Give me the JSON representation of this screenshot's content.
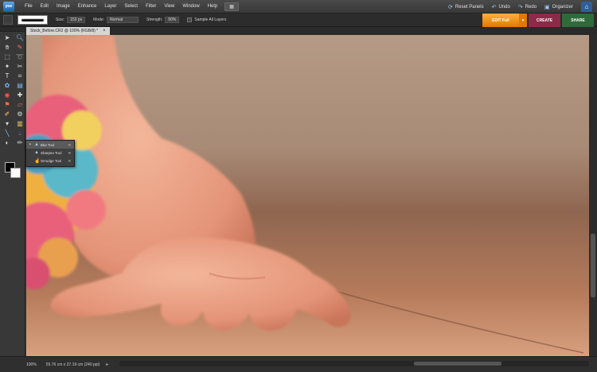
{
  "app": {
    "logo": "pse"
  },
  "menu": [
    "File",
    "Edit",
    "Image",
    "Enhance",
    "Layer",
    "Select",
    "Filter",
    "View",
    "Window",
    "Help"
  ],
  "right_actions": {
    "reset_panels": "Reset Panels",
    "undo": "Undo",
    "redo": "Redo",
    "organizer": "Organizer"
  },
  "options": {
    "size_label": "Size:",
    "size_value": "153 px",
    "mode_label": "Mode:",
    "mode_value": "Normal",
    "strength_label": "Strength:",
    "strength_value": "50%",
    "sample_all_layers": "Sample All Layers"
  },
  "modes": {
    "edit": "EDIT Full",
    "create": "CREATE",
    "share": "SHARE"
  },
  "document_tab": {
    "title": "Stock_Before.CR2 @ 100% (RGB/8) *",
    "close": "×"
  },
  "flyout": {
    "items": [
      {
        "label": "Blur Tool",
        "icon": "drop-icon",
        "key": "R",
        "active": true
      },
      {
        "label": "Sharpen Tool",
        "icon": "triangle-icon",
        "key": "R",
        "active": false
      },
      {
        "label": "Smudge Tool",
        "icon": "finger-icon",
        "key": "R",
        "active": false
      }
    ]
  },
  "status": {
    "zoom": "100%",
    "doc_info": "55.76 cm x 37.19 cm (240 ppi)"
  },
  "colors": {
    "edit_accent": "#e98a0c",
    "create": "#8b2b4a",
    "share": "#2e6a3a",
    "foreground": "#000000",
    "background": "#ffffff"
  }
}
